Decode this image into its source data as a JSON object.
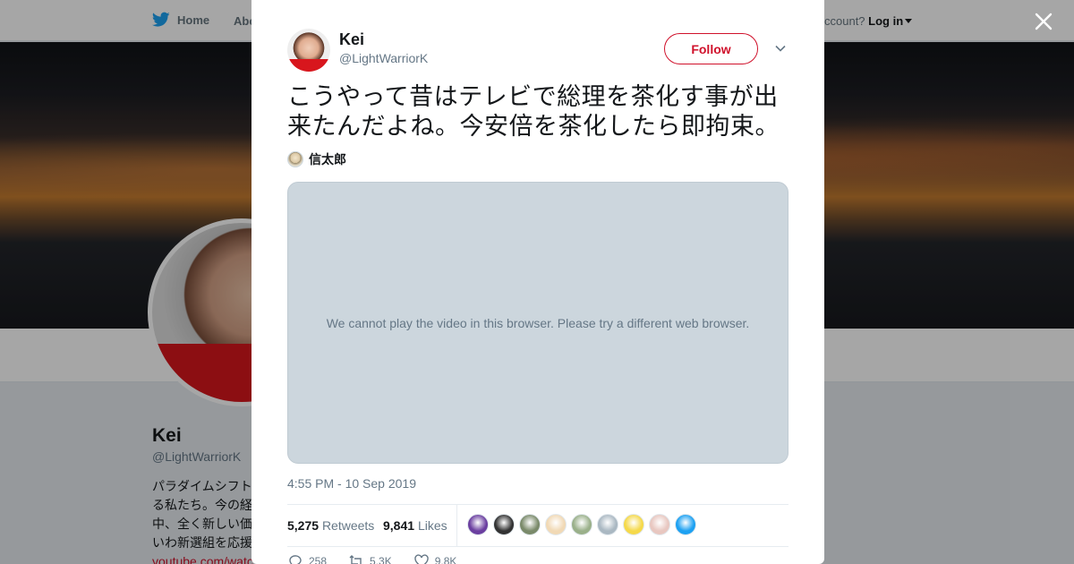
{
  "nav": {
    "home_label": "Home",
    "about_label": "About",
    "login_prefix": "ccount?",
    "login_label": "Log in"
  },
  "profile": {
    "name": "Kei",
    "handle": "@LightWarriorK",
    "bio_lines": [
      "パラダイムシフト",
      "る私たち。今の経",
      "中、全く新しい価",
      "いわ新選組を応援"
    ],
    "bio_link": "youtube.com/watc"
  },
  "tweet": {
    "author_name": "Kei",
    "author_handle": "@LightWarriorK",
    "follow_label": "Follow",
    "text": "こうやって昔はテレビで総理を茶化す事が出来たんだよね。今安倍を茶化したら即拘束。",
    "mention_name": "信太郎",
    "video_message": "We cannot play the video in this browser. Please try a different web browser.",
    "timestamp": "4:55 PM - 10 Sep 2019",
    "retweets_count": "5,275",
    "retweets_label": "Retweets",
    "likes_count": "9,841",
    "likes_label": "Likes",
    "reply_count": "258",
    "retweet_action_count": "5.3K",
    "like_action_count": "9.8K",
    "liker_colors": [
      "#6b3fa0",
      "#333333",
      "#7a8a6a",
      "#f1d9b5",
      "#9ab08a",
      "#aab8c2",
      "#f5d94a",
      "#e8c7c0",
      "#1da1f2"
    ]
  },
  "colors": {
    "accent": "#d0112b",
    "muted": "#657786",
    "video_bg": "#ccd6dd"
  }
}
